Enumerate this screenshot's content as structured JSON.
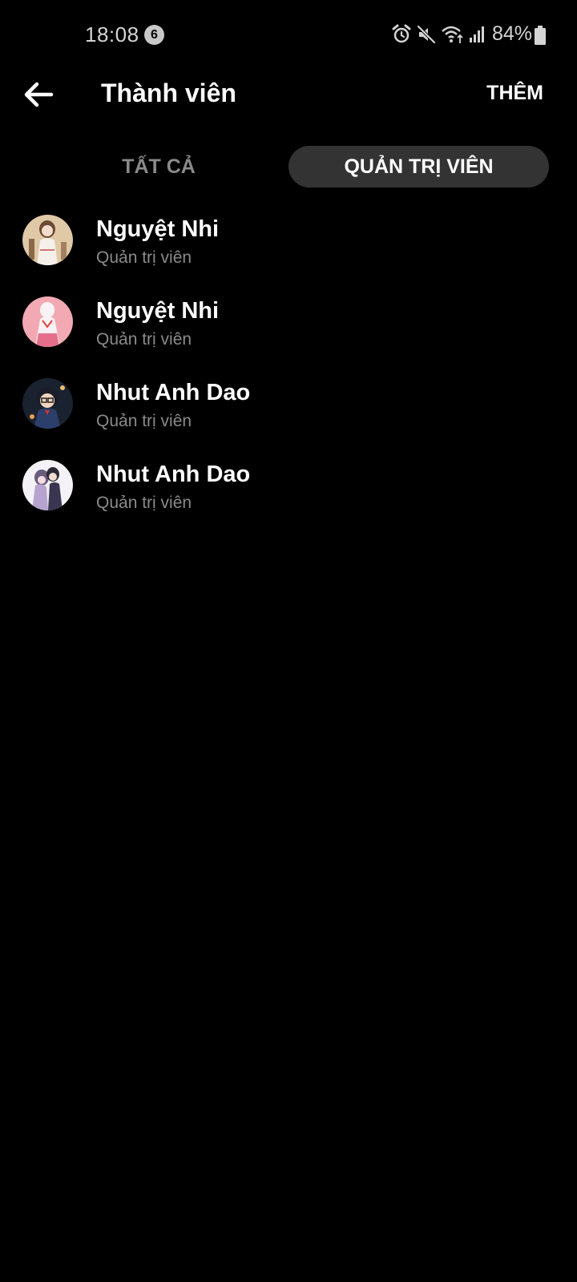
{
  "status_bar": {
    "time": "18:08",
    "notification_count": "6",
    "battery_percent": "84%",
    "icons": [
      "alarm-icon",
      "mute-icon",
      "wifi-icon",
      "signal-icon",
      "battery-icon"
    ]
  },
  "header": {
    "back_icon": "arrow-left-icon",
    "title": "Thành viên",
    "add_label": "THÊM"
  },
  "tabs": [
    {
      "label": "TẤT CẢ",
      "active": false
    },
    {
      "label": "QUẢN TRỊ VIÊN",
      "active": true
    }
  ],
  "members": [
    {
      "name": "Nguyệt Nhi",
      "role": "Quản trị viên"
    },
    {
      "name": "Nguyệt Nhi",
      "role": "Quản trị viên"
    },
    {
      "name": "Nhut Anh Dao",
      "role": "Quản trị viên"
    },
    {
      "name": "Nhut Anh Dao",
      "role": "Quản trị viên"
    }
  ],
  "colors": {
    "background": "#000000",
    "active_tab_bg": "#333333",
    "secondary_text": "#8a8a8a",
    "primary_text": "#ffffff"
  }
}
